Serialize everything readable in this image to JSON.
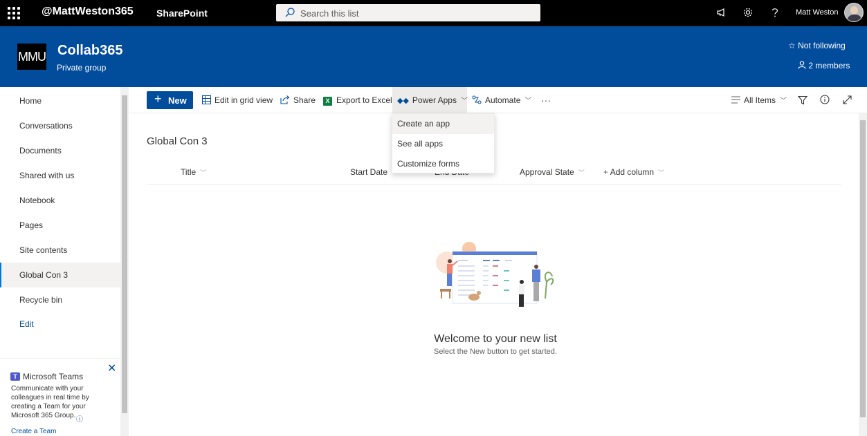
{
  "suitebar": {
    "tenant": "@MattWeston365",
    "app_name": "SharePoint",
    "search_placeholder": "Search this list",
    "user_name": "Matt Weston",
    "icons": [
      "waffle-icon",
      "megaphone-icon",
      "gear-icon",
      "help-icon"
    ]
  },
  "site": {
    "logo_text": "MMU",
    "title": "Collab365",
    "subtitle": "Private group",
    "follow_label": "Not following",
    "members_label": "2 members"
  },
  "nav": {
    "items": [
      {
        "label": "Home"
      },
      {
        "label": "Conversations"
      },
      {
        "label": "Documents"
      },
      {
        "label": "Shared with us"
      },
      {
        "label": "Notebook"
      },
      {
        "label": "Pages"
      },
      {
        "label": "Site contents"
      },
      {
        "label": "Global Con 3"
      },
      {
        "label": "Recycle bin"
      }
    ],
    "active_label": "Global Con 3",
    "edit_label": "Edit"
  },
  "teams_promo": {
    "title": "Microsoft Teams",
    "description": "Communicate with your colleagues in real time by creating a Team for your Microsoft 365 Group.",
    "link": "Create a Team"
  },
  "commandbar": {
    "new_label": "New",
    "edit_grid_label": "Edit in grid view",
    "share_label": "Share",
    "export_label": "Export to Excel",
    "powerapps_label": "Power Apps",
    "automate_label": "Automate",
    "more_label": "···",
    "view_label": "All Items"
  },
  "powerapps_menu": {
    "items": [
      "Create an app",
      "See all apps",
      "Customize forms"
    ]
  },
  "list": {
    "title": "Global Con 3",
    "columns": [
      "Title",
      "Start Date",
      "End Date",
      "Approval State"
    ],
    "add_column_label": "Add column",
    "empty_title": "Welcome to your new list",
    "empty_subtitle": "Select the New button to get started."
  },
  "colors": {
    "suitebar_bg": "#000000",
    "brand": "#024c9c",
    "accent": "#0078d4"
  }
}
